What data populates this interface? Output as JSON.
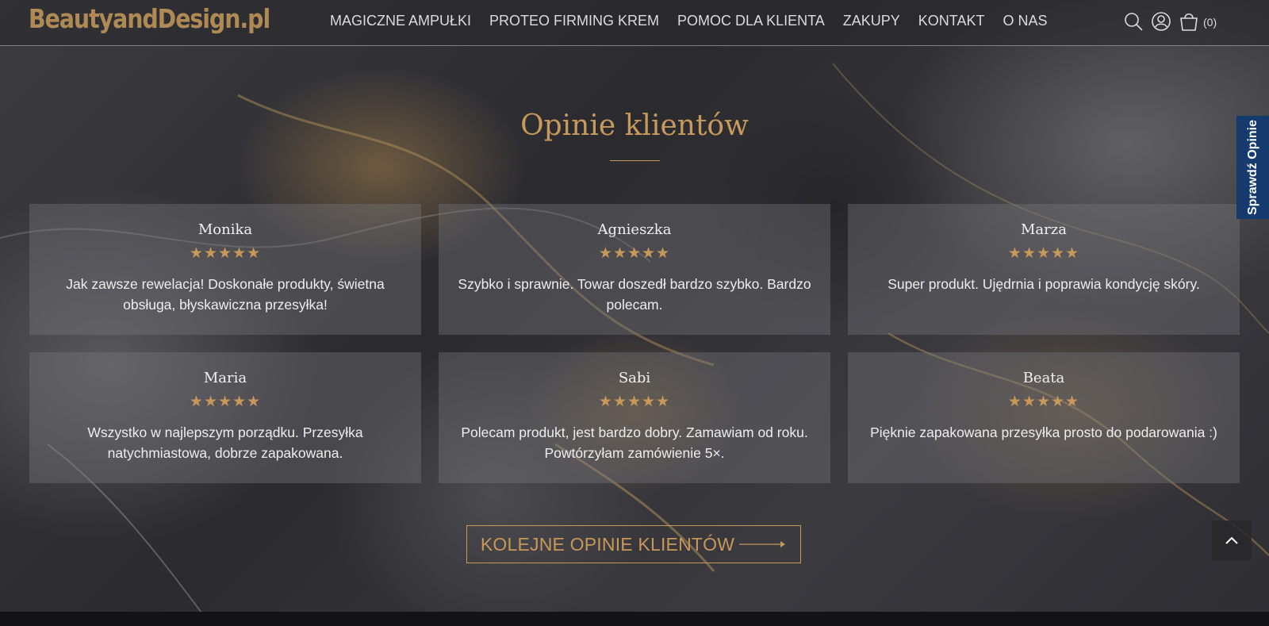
{
  "header": {
    "logo": "BeautyandDesign.pl",
    "nav": [
      "MAGICZNE AMPUŁKI",
      "PROTEO FIRMING KREM",
      "POMOC DLA KLIENTA",
      "ZAKUPY",
      "KONTAKT",
      "O NAS"
    ],
    "cart_count": "(0)",
    "icons": [
      "search-icon",
      "user-icon",
      "cart-icon"
    ]
  },
  "reviews_section": {
    "title": "Opinie klientów",
    "reviews": [
      {
        "name": "Monika",
        "stars": "★★★★★",
        "rating": 5,
        "text": "Jak zawsze rewelacja! Doskonałe produkty, świetna obsługa, błyskawiczna przesyłka!"
      },
      {
        "name": "Agnieszka",
        "stars": "★★★★★",
        "rating": 5,
        "text": "Szybko i sprawnie. Towar doszedł bardzo szybko. Bardzo polecam."
      },
      {
        "name": "Marza",
        "stars": "★★★★★",
        "rating": 5,
        "text": "Super produkt. Ujędrnia i poprawia kondycję skóry."
      },
      {
        "name": "Maria",
        "stars": "★★★★★",
        "rating": 5,
        "text": "Wszystko w najlepszym porządku. Przesyłka natychmiastowa, dobrze zapakowana."
      },
      {
        "name": "Sabi",
        "stars": "★★★★★",
        "rating": 5,
        "text": "Polecam produkt, jest bardzo dobry. Zamawiam od roku. Powtórzyłam zamówienie 5×."
      },
      {
        "name": "Beata",
        "stars": "★★★★★",
        "rating": 5,
        "text": "Pięknie zapakowana przesyłka prosto do podarowania :)"
      }
    ],
    "more_button": "KOLEJNE OPINIE KLIENTÓW"
  },
  "side_tab": "Sprawdź Opinie",
  "colors": {
    "accent": "#c79a5c",
    "side_tab": "#153a6e"
  }
}
